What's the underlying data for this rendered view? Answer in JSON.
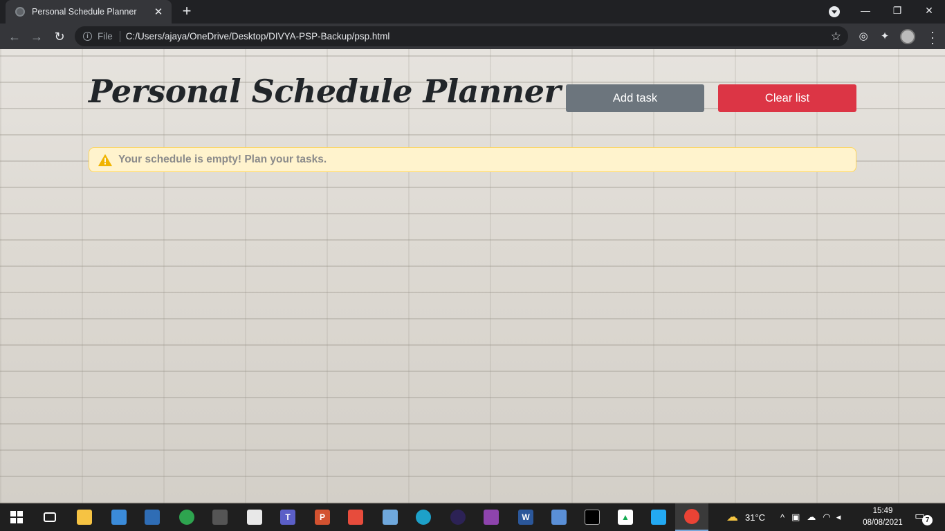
{
  "browser": {
    "tab_title": "Personal Schedule Planner",
    "url_scheme_label": "File",
    "url": "C:/Users/ajaya/OneDrive/Desktop/DIVYA-PSP-Backup/psp.html"
  },
  "page": {
    "title": "Personal Schedule Planner",
    "add_button": "Add task",
    "clear_button": "Clear list",
    "alert_message": "Your schedule is empty! Plan your tasks.",
    "colors": {
      "add": "#6c757d",
      "clear": "#dc3545",
      "alert_bg": "#fff3cd",
      "alert_border": "#ffd65a"
    }
  },
  "taskbar": {
    "weather_temp": "31°C",
    "time": "15:49",
    "date": "08/08/2021",
    "notification_count": "7",
    "apps": [
      "start",
      "task-view",
      "file-explorer",
      "network-app",
      "terminal-app",
      "atom",
      "cmd",
      "notepad",
      "teams",
      "powerpoint",
      "office",
      "photos",
      "edge",
      "eclipse",
      "winrar",
      "word",
      "virtualbox",
      "console",
      "mongodb",
      "vscode",
      "chrome"
    ]
  }
}
